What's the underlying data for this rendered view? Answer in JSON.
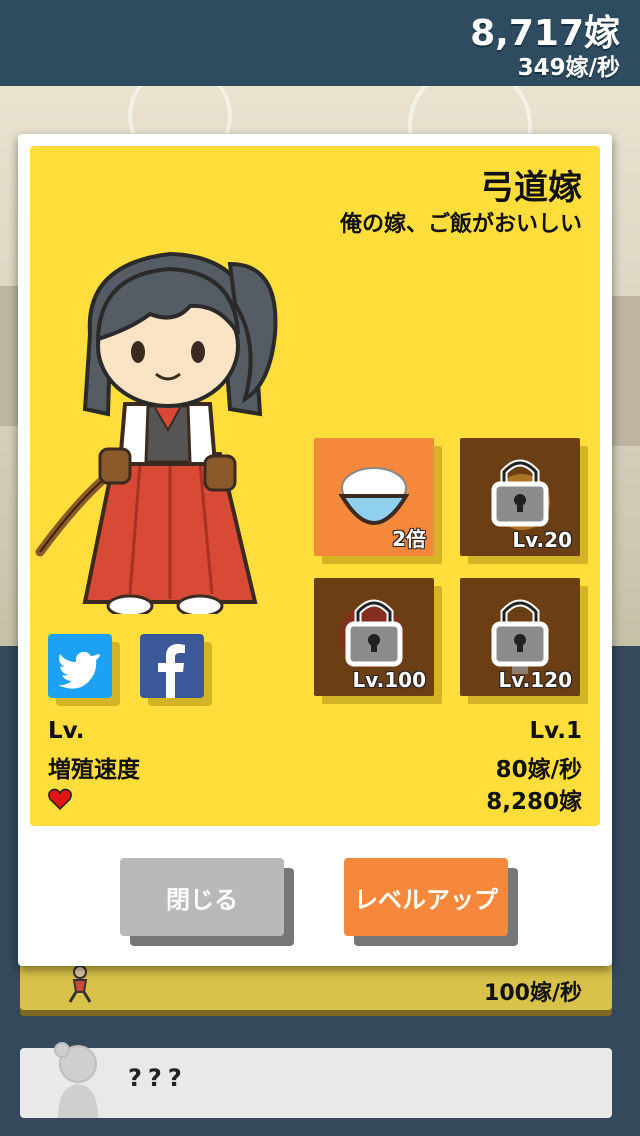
{
  "header": {
    "total_yome": "8,717嫁",
    "rate": "349嫁/秒"
  },
  "background": {
    "card_rate": "100嫁/秒",
    "locked_label": "???"
  },
  "dialog": {
    "name": "弓道嫁",
    "description": "俺の嫁、ご飯がおいしい",
    "items": [
      {
        "label": "2倍",
        "icon": "rice-bowl-icon",
        "locked": false
      },
      {
        "label": "Lv.20",
        "icon": "lock-icon",
        "locked": true
      },
      {
        "label": "Lv.100",
        "icon": "lock-icon",
        "locked": true
      },
      {
        "label": "Lv.120",
        "icon": "lock-icon",
        "locked": true
      }
    ],
    "social": {
      "twitter": "twitter-icon",
      "facebook": "facebook-icon"
    },
    "stats": {
      "level_label": "Lv.",
      "level_value": "Lv.1",
      "speed_label": "増殖速度",
      "speed_value": "80嫁/秒",
      "heart_value": "8,280嫁"
    },
    "buttons": {
      "close": "閉じる",
      "level_up": "レベルアップ"
    }
  },
  "colors": {
    "panel": "#ffdd3b",
    "orange": "#f5883a",
    "brown": "#6b3e14",
    "twitter": "#1da1f2",
    "facebook": "#3b5998",
    "close_button": "#b9b9b9",
    "levelup_button": "#f5883a"
  }
}
